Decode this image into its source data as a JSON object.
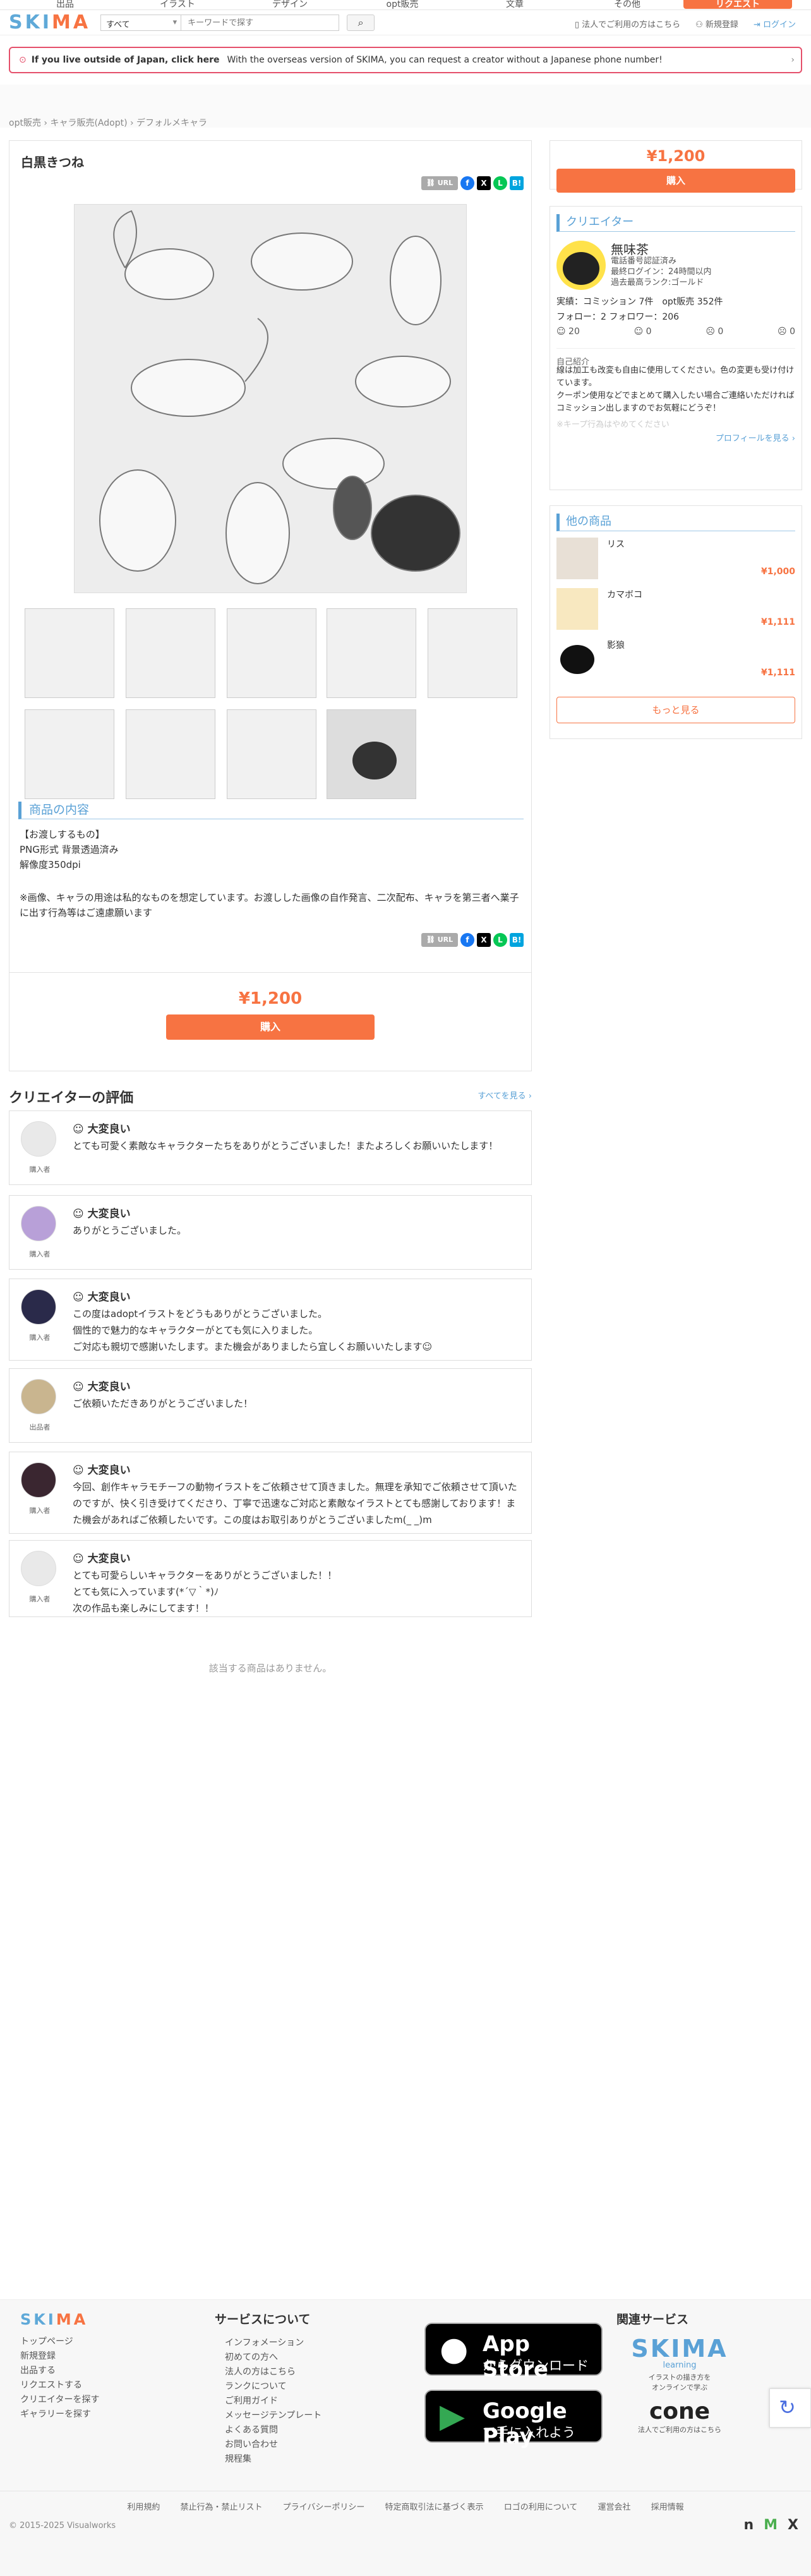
{
  "topnav": {
    "items": [
      "出品",
      "イラスト",
      "デザイン",
      "opt販売",
      "文章",
      "その他"
    ],
    "request": "リクエスト"
  },
  "header": {
    "logo_a": "SKI",
    "logo_b": "MA",
    "category": "すべて",
    "search_placeholder": "キーワードで探す",
    "links": [
      "法人でご利用の方はこちら",
      "新規登録",
      "ログイン"
    ]
  },
  "banner": {
    "bold": "If you live outside of Japan, click here",
    "text": "With the overseas version of SKIMA, you can request a creator without a Japanese phone number!"
  },
  "breadcrumb": [
    "opt販売",
    "キャラ販売(Adopt)",
    "デフォルメキャラ"
  ],
  "product": {
    "title": "白黒きつね",
    "url_label": "URL",
    "section": "商品の内容",
    "desc1": "【お渡しするもの】\nPNG形式 背景透過済み\n解像度350dpi",
    "desc2": "※画像、キャラの用途は私的なものを想定しています。お渡しした画像の自作発言、二次配布、キャラを第三者へ業子に出す行為等はご遠慮願います",
    "price": "¥1,200",
    "buy": "購入"
  },
  "sidebar": {
    "price": "¥1,200",
    "buy": "購入",
    "creator_head": "クリエイター",
    "creator_name": "無味茶",
    "badges": [
      "電話番号認証済み",
      "最終ログイン：24時間以内",
      "過去最高ランク:ゴールド"
    ],
    "stats": "実績：コミッション 7件　opt販売 352件",
    "follow": "フォロー：2 フォロワー：206",
    "reactions": [
      "20",
      "0",
      "0",
      "0"
    ],
    "intro_head": "自己紹介",
    "intro": "線は加工も改変も自由に使用してください。色の変更も受け付けています。\nクーポン使用などでまとめて購入したい場合ご連絡いただければコミッション出しますのでお気軽にどうぞ！",
    "intro_fade": "※キープ行為はやめてください",
    "profile_link": "プロフィールを見る ›",
    "other_head": "他の商品",
    "items": [
      {
        "name": "リス",
        "price": "¥1,000"
      },
      {
        "name": "カマボコ",
        "price": "¥1,111"
      },
      {
        "name": "影狼",
        "price": "¥1,111"
      }
    ],
    "more": "もっと見る"
  },
  "reviews": {
    "head": "クリエイターの評価",
    "all": "すべてを見る ›",
    "items": [
      {
        "rating": "大変良い",
        "text": "とても可愛く素敵なキャラクターたちをありがとうございました！またよろしくお願いいたします！",
        "role": "購入者"
      },
      {
        "rating": "大変良い",
        "text": "ありがとうございました。",
        "role": "購入者"
      },
      {
        "rating": "大変良い",
        "text": "この度はadoptイラストをどうもありがとうございました。\n個性的で魅力的なキャラクターがとても気に入りました。\nご対応も親切で感謝いたします。また機会がありましたら宜しくお願いいたします☺",
        "role": "購入者"
      },
      {
        "rating": "大変良い",
        "text": "ご依頼いただきありがとうございました！",
        "role": "出品者"
      },
      {
        "rating": "大変良い",
        "text": "今回、創作キャラモチーフの動物イラストをご依頼させて頂きました。無理を承知でご依頼させて頂いたのですが、快く引き受けてくださり、丁寧で迅速なご対応と素敵なイラストとても感謝しております！また機会があればご依頼したいです。この度はお取引ありがとうございましたm(_ _)m",
        "role": "購入者"
      },
      {
        "rating": "大変良い",
        "text": "とても可愛らしいキャラクターをありがとうございました！！\nとても気に入っています(*´▽｀*)ﾉ\n次の作品も楽しみにしてます！！",
        "role": "購入者"
      }
    ]
  },
  "empty": "該当する商品はありません。",
  "footer": {
    "col1": [
      "トップページ",
      "新規登録",
      "出品する",
      "リクエストする",
      "クリエイターを探す",
      "ギャラリーを探す"
    ],
    "service_head": "サービスについて",
    "service": [
      "インフォメーション",
      "初めての方へ",
      "法人の方はこちら",
      "ランクについて",
      "ご利用ガイド",
      "メッセージテンプレート",
      "よくある質問",
      "お問い合わせ",
      "規程集"
    ],
    "appstore_a": "App Store",
    "appstore_b": "からダウンロード",
    "gplay_a": "Google Play",
    "gplay_b": "で手に入れよう",
    "related_head": "関連サービス",
    "learning": "SKIMA",
    "learning_sub": "learning",
    "learning_desc": "イラストの描き方を\nオンラインで学ぶ",
    "cone": "cone",
    "cone_desc": "法人でご利用の方はこちら",
    "links": [
      "利用規約",
      "禁止行為・禁止リスト",
      "プライバシーポリシー",
      "特定商取引法に基づく表示",
      "ロゴの利用について",
      "運営会社",
      "採用情報"
    ],
    "copy": "© 2015-2025 Visualworks"
  },
  "colors": {
    "accent": "#f77342",
    "blue": "#5aa1d6"
  }
}
